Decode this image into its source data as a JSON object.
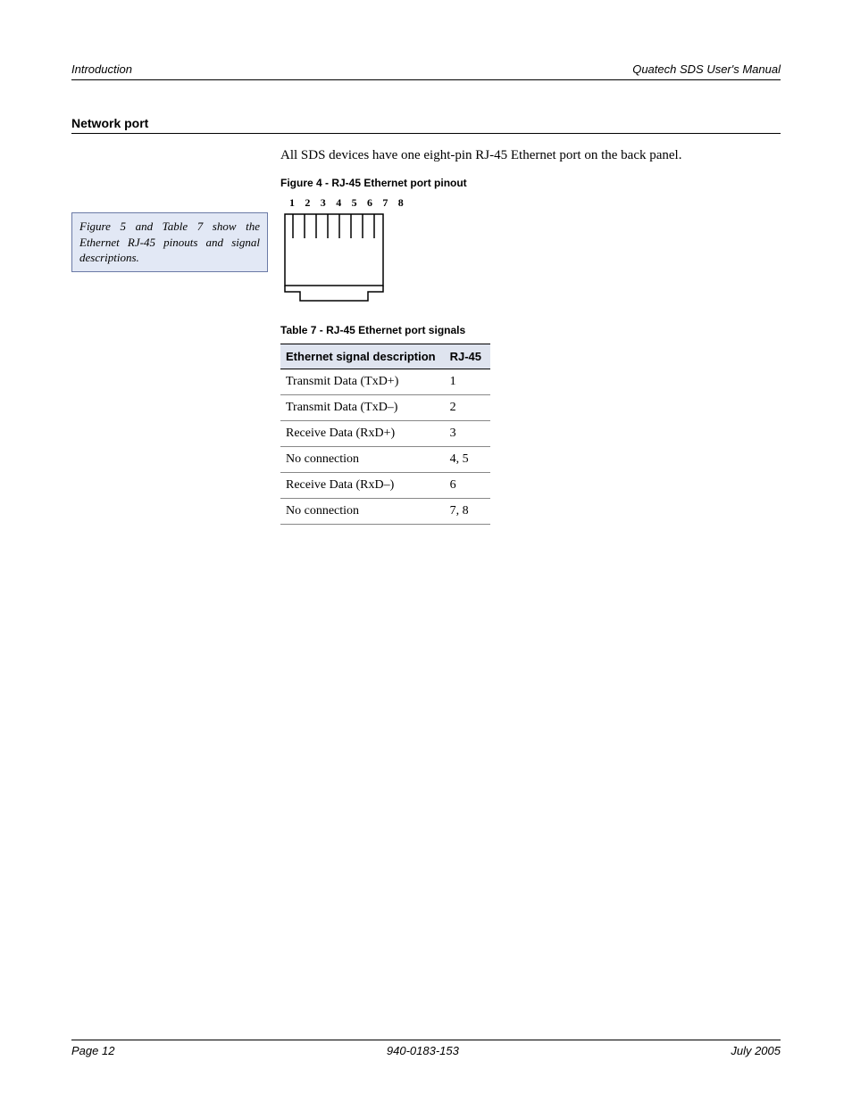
{
  "header": {
    "left": "Introduction",
    "right": "Quatech SDS User's Manual"
  },
  "section_title": "Network port",
  "intro": "All SDS devices have one eight-pin RJ-45 Ethernet port on the back panel.",
  "callout": "Figure 5 and Table 7 show the Ethernet RJ-45 pinouts and signal descriptions.",
  "figure": {
    "caption": "Figure 4 - RJ-45 Ethernet port pinout",
    "pins": "1 2 3 4 5 6 7 8"
  },
  "table": {
    "caption": "Table 7 - RJ-45 Ethernet port signals",
    "headers": {
      "desc": "Ethernet signal description",
      "pin": "RJ-45"
    },
    "rows": [
      {
        "desc": "Transmit Data (TxD+)",
        "pin": "1"
      },
      {
        "desc": "Transmit Data (TxD–)",
        "pin": "2"
      },
      {
        "desc": "Receive Data (RxD+)",
        "pin": "3"
      },
      {
        "desc": "No connection",
        "pin": "4, 5"
      },
      {
        "desc": "Receive Data (RxD–)",
        "pin": "6"
      },
      {
        "desc": "No connection",
        "pin": "7, 8"
      }
    ]
  },
  "footer": {
    "left": "Page 12",
    "center": "940-0183-153",
    "right": "July 2005"
  }
}
